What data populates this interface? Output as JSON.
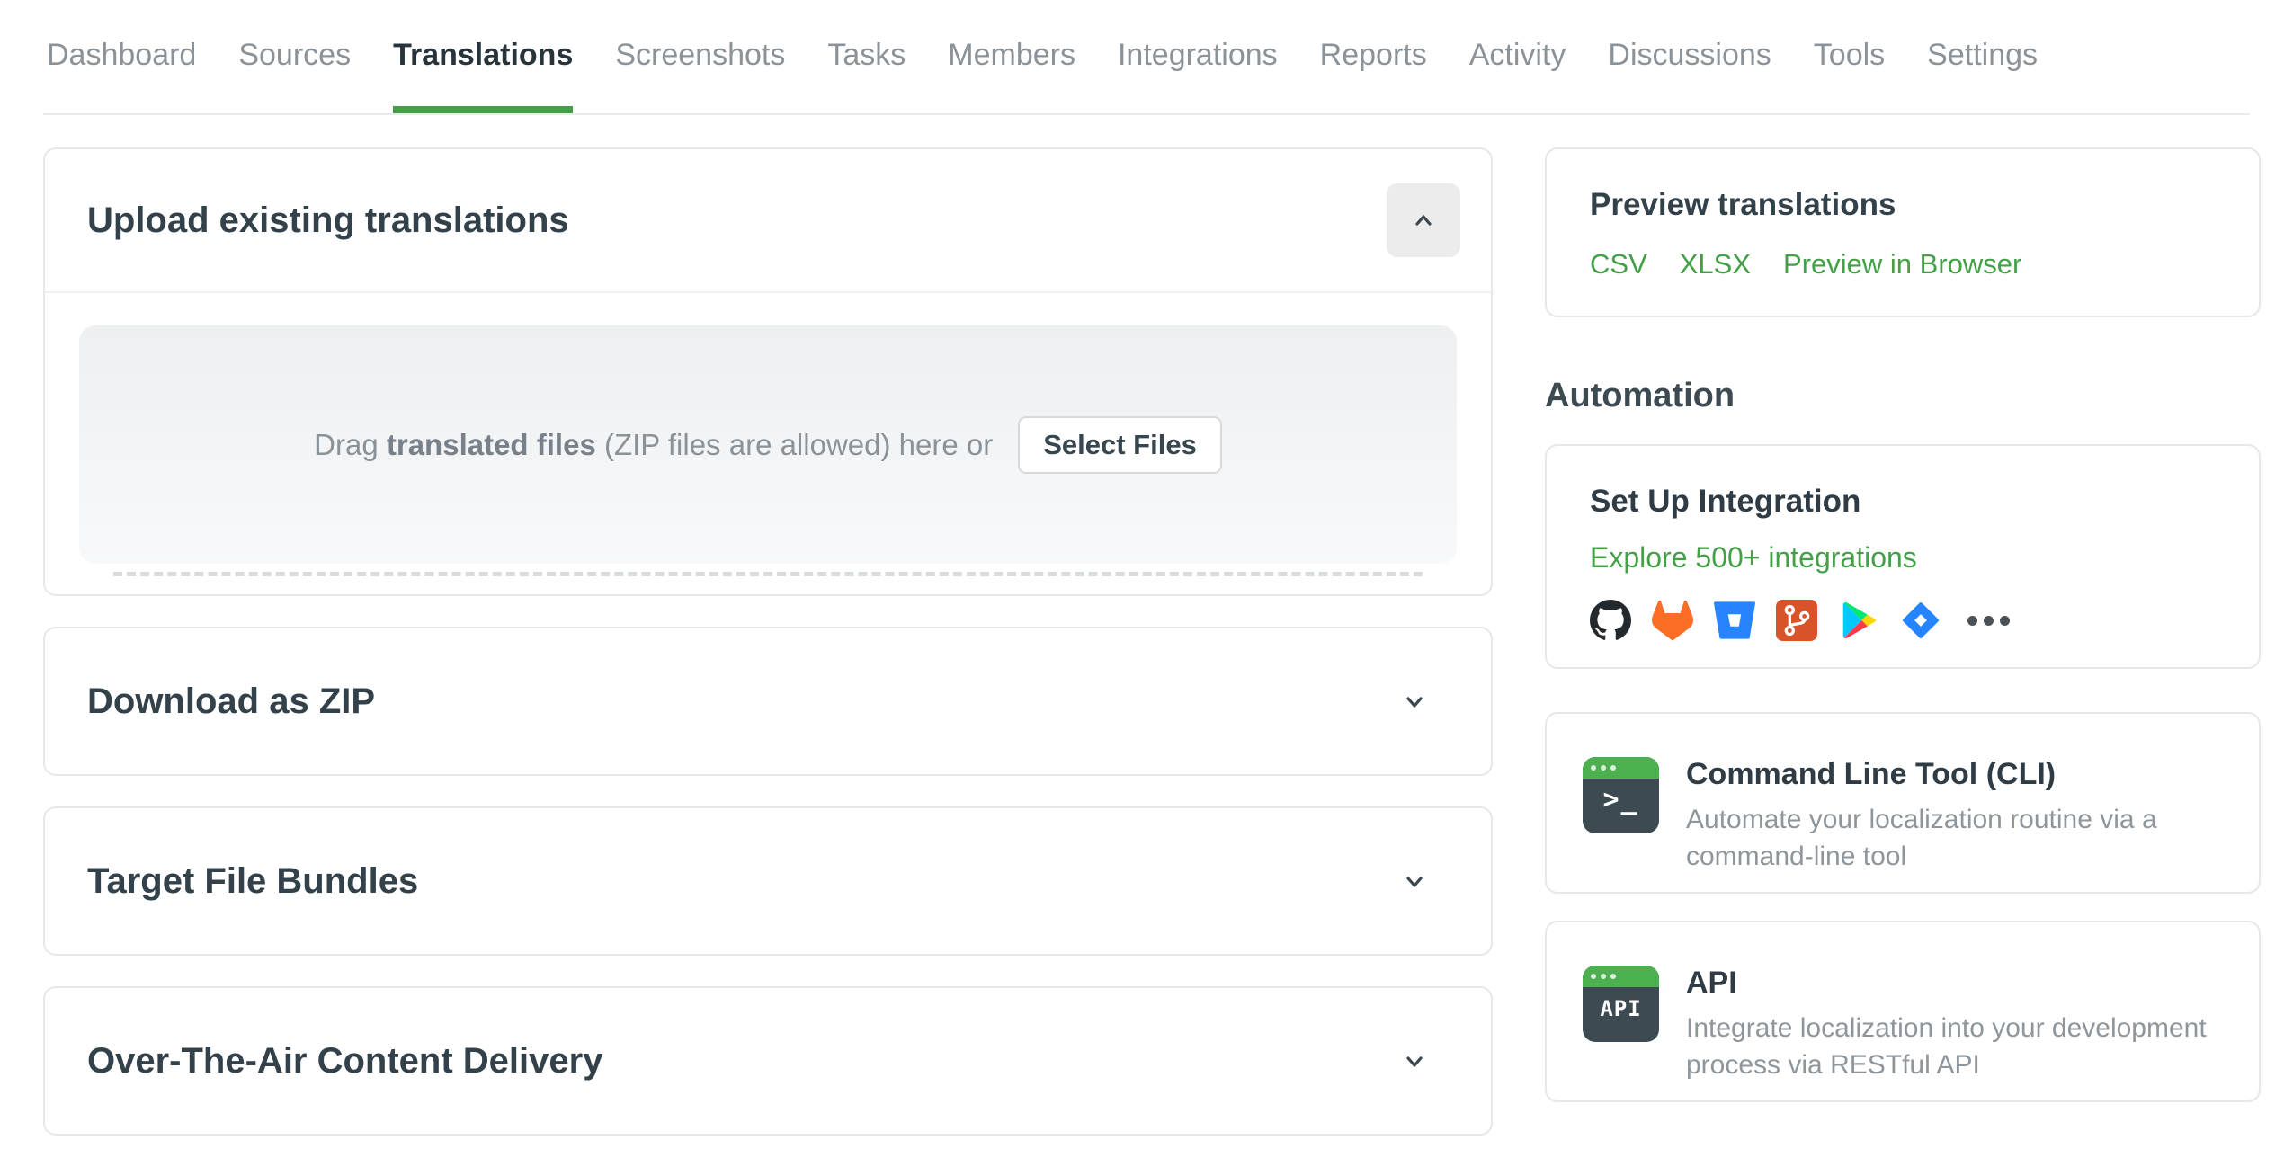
{
  "nav": {
    "tabs": [
      {
        "label": "Dashboard"
      },
      {
        "label": "Sources"
      },
      {
        "label": "Translations",
        "active": true
      },
      {
        "label": "Screenshots"
      },
      {
        "label": "Tasks"
      },
      {
        "label": "Members"
      },
      {
        "label": "Integrations"
      },
      {
        "label": "Reports"
      },
      {
        "label": "Activity"
      },
      {
        "label": "Discussions"
      },
      {
        "label": "Tools"
      },
      {
        "label": "Settings"
      }
    ]
  },
  "main": {
    "upload": {
      "title": "Upload existing translations",
      "collapse_icon": "chevron-up-icon",
      "dropzone": {
        "drag_prefix": "Drag",
        "drag_bold": "translated files",
        "drag_suffix": "(ZIP files are allowed) here or",
        "select_button": "Select Files"
      }
    },
    "sections": [
      {
        "title": "Download as ZIP"
      },
      {
        "title": "Target File Bundles"
      },
      {
        "title": "Over-The-Air Content Delivery"
      }
    ]
  },
  "sidebar": {
    "preview": {
      "title": "Preview translations",
      "links": [
        {
          "label": "CSV"
        },
        {
          "label": "XLSX"
        },
        {
          "label": "Preview in Browser"
        }
      ]
    },
    "automation_heading": "Automation",
    "integration": {
      "title": "Set Up Integration",
      "link": "Explore 500+ integrations",
      "icons": [
        {
          "name": "github-icon"
        },
        {
          "name": "gitlab-icon"
        },
        {
          "name": "bitbucket-icon"
        },
        {
          "name": "git-icon"
        },
        {
          "name": "google-play-icon"
        },
        {
          "name": "jira-icon"
        },
        {
          "name": "more-integrations-icon"
        }
      ]
    },
    "tools": [
      {
        "title": "Command Line Tool (CLI)",
        "description": "Automate your localization routine via a command-line tool",
        "icon_label": ">_"
      },
      {
        "title": "API",
        "description": "Integrate localization into your development process via RESTful API",
        "icon_label": "API"
      }
    ]
  },
  "colors": {
    "accent_green": "#43a047",
    "title_dark": "#33414b",
    "muted_gray": "#8b9298"
  }
}
